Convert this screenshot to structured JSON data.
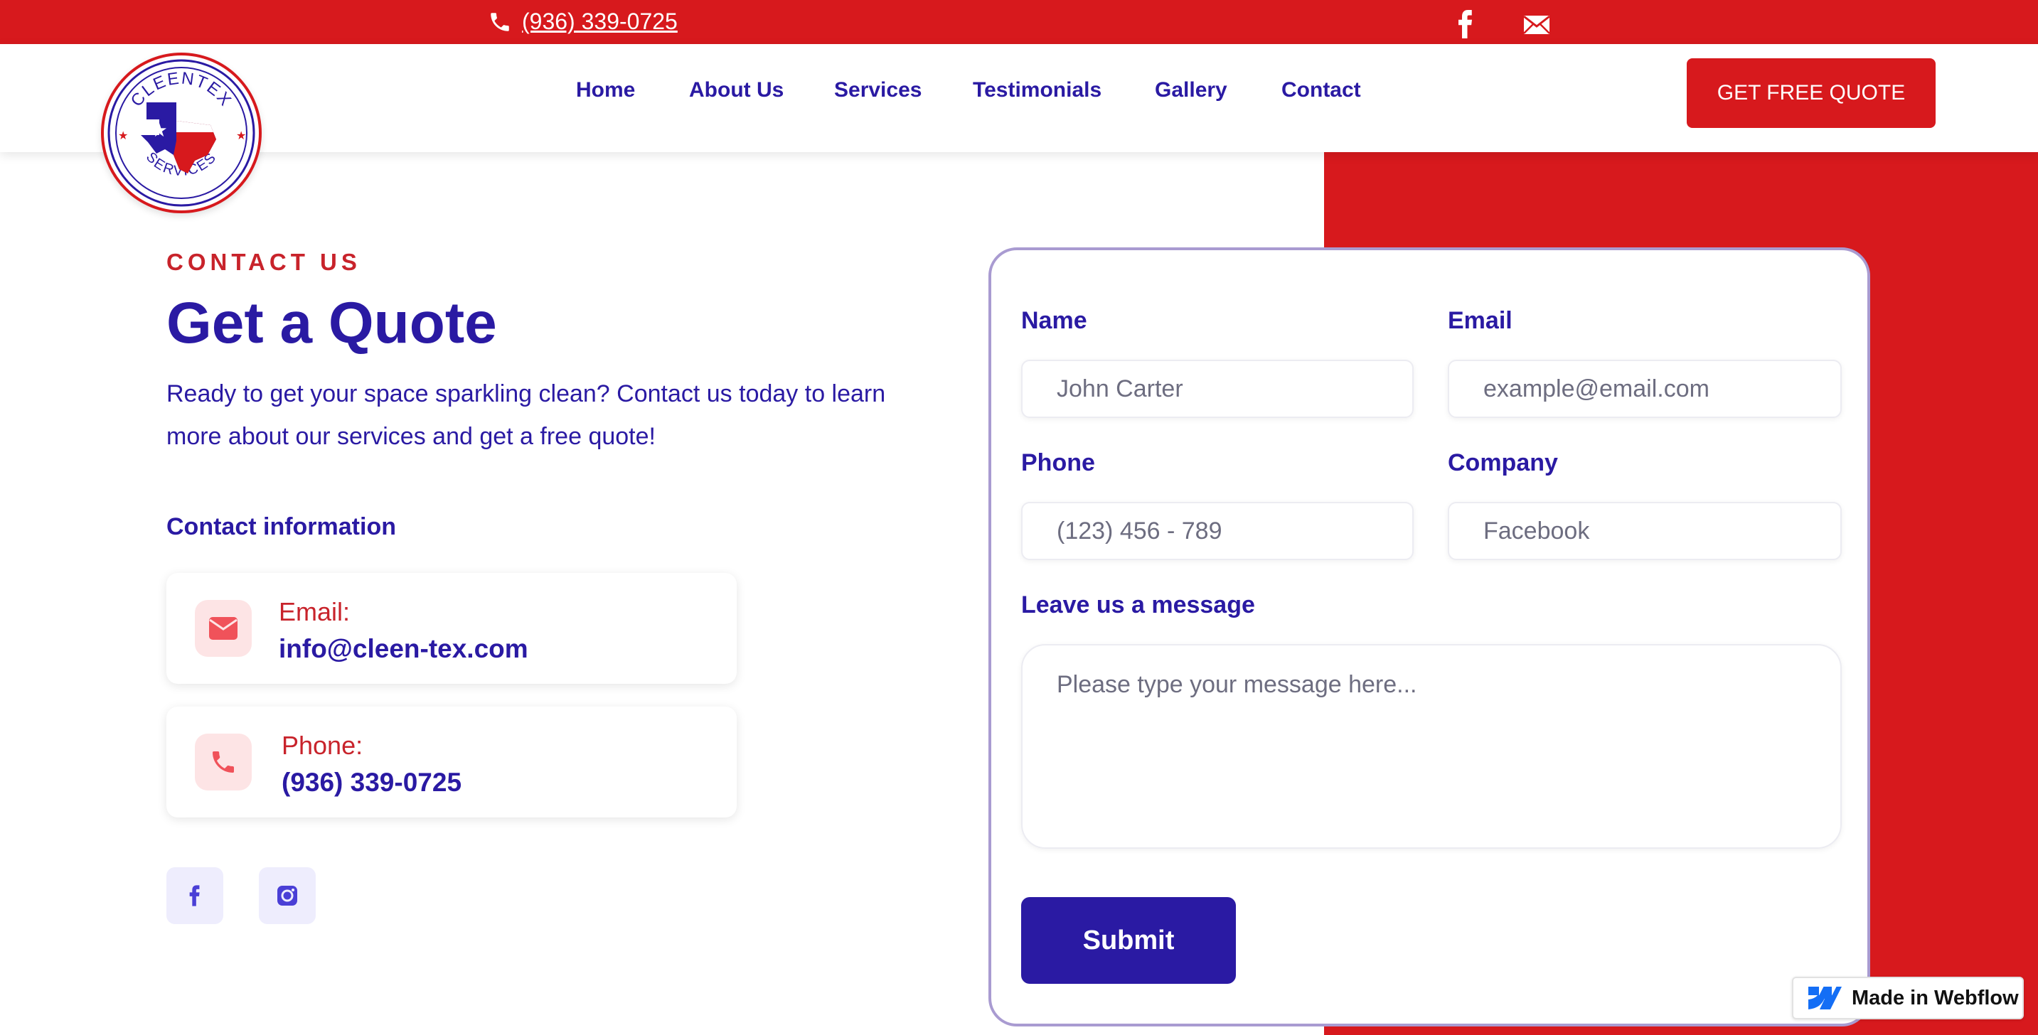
{
  "topbar": {
    "phone": "(936) 339-0725",
    "icons": [
      "phone-icon",
      "facebook-icon",
      "mail-icon"
    ]
  },
  "header": {
    "logo_text_top": "CLEENTEX",
    "logo_text_bottom": "SERVICES",
    "nav": [
      {
        "label": "Home"
      },
      {
        "label": "About Us"
      },
      {
        "label": "Services"
      },
      {
        "label": "Testimonials"
      },
      {
        "label": "Gallery"
      },
      {
        "label": "Contact"
      }
    ],
    "cta_label": "GET FREE QUOTE"
  },
  "contact": {
    "eyebrow": "CONTACT US",
    "title": "Get a Quote",
    "description": "Ready to get your space sparkling clean? Contact us today to learn more about our services and get a free quote!",
    "info_heading": "Contact information",
    "cards": [
      {
        "label": "Email:",
        "value": "info@cleen-tex.com",
        "icon": "mail-icon"
      },
      {
        "label": "Phone:",
        "value": "(936) 339-0725",
        "icon": "phone-icon"
      }
    ],
    "socials": [
      "facebook-icon",
      "instagram-icon"
    ]
  },
  "form": {
    "name_label": "Name",
    "name_placeholder": "John Carter",
    "email_label": "Email",
    "email_placeholder": "example@email.com",
    "phone_label": "Phone",
    "phone_placeholder": "(123) 456 - 789",
    "company_label": "Company",
    "company_placeholder": "Facebook",
    "message_label": "Leave us a message",
    "message_placeholder": "Please type your message here...",
    "submit_label": "Submit"
  },
  "badge": {
    "label": "Made in Webflow"
  },
  "colors": {
    "brand_red": "#d7191d",
    "brand_navy": "#2a1aa3",
    "form_border": "#a99bd1",
    "icon_bg_pink": "#fde4e5",
    "social_bg": "#eeedfd"
  }
}
